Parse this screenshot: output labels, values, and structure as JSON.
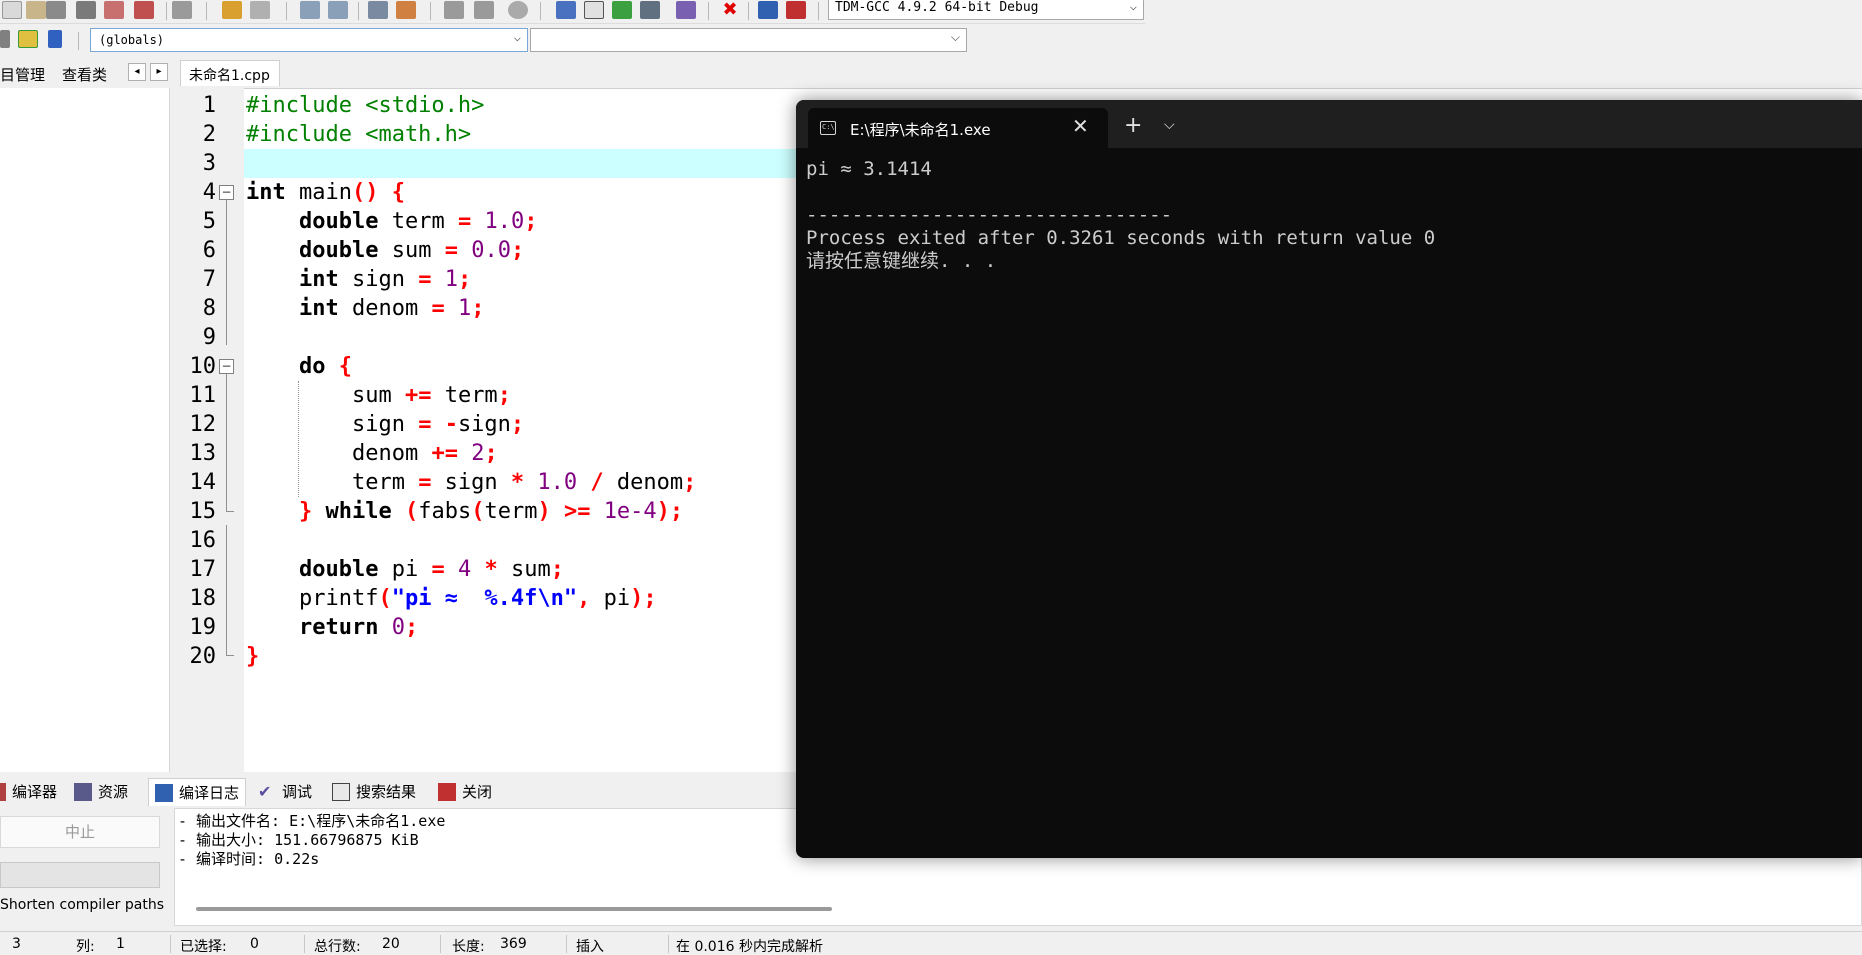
{
  "toolbar": {
    "compiler": "TDM-GCC 4.9.2 64-bit Debug",
    "scope": "(globals)"
  },
  "left_panel": {
    "tabs": [
      "目管理",
      "查看类"
    ]
  },
  "editor": {
    "file_tab": "未命名1.cpp",
    "current_line": 3,
    "lines": [
      "#include <stdio.h>",
      "#include <math.h>",
      "",
      "int main() {",
      "    double term = 1.0;",
      "    double sum = 0.0;",
      "    int sign = 1;",
      "    int denom = 1;",
      "",
      "    do {",
      "        sum += term;",
      "        sign = -sign;",
      "        denom += 2;",
      "        term = sign * 1.0 / denom;",
      "    } while (fabs(term) >= 1e-4);",
      "",
      "    double pi = 4 * sum;",
      "    printf(\"pi ≈  %.4f\\n\", pi);",
      "    return 0;",
      "}"
    ],
    "line_numbers": [
      "1",
      "2",
      "3",
      "4",
      "5",
      "6",
      "7",
      "8",
      "9",
      "10",
      "11",
      "12",
      "13",
      "14",
      "15",
      "16",
      "17",
      "18",
      "19",
      "20"
    ]
  },
  "bottom_panel": {
    "tabs": [
      {
        "label": "编译器",
        "icon": "compiler-icon"
      },
      {
        "label": "资源",
        "icon": "resources-icon"
      },
      {
        "label": "编译日志",
        "icon": "compile-log-icon"
      },
      {
        "label": "调试",
        "icon": "debug-icon"
      },
      {
        "label": "搜索结果",
        "icon": "search-results-icon"
      },
      {
        "label": "关闭",
        "icon": "close-icon"
      }
    ],
    "abort_label": "中止",
    "shorten_label": "Shorten compiler paths",
    "log_lines": [
      "- 输出文件名: E:\\程序\\未命名1.exe",
      "- 输出大小: 151.66796875 KiB",
      "- 编译时间: 0.22s"
    ]
  },
  "statusbar": {
    "row": "3",
    "col_label": "列:",
    "col": "1",
    "selected_label": "已选择:",
    "selected": "0",
    "total_lines_label": "总行数:",
    "total_lines": "20",
    "length_label": "长度:",
    "length": "369",
    "mode": "插入",
    "parse_msg": "在 0.016 秒内完成解析"
  },
  "terminal": {
    "tab_title": "E:\\程序\\未命名1.exe",
    "output": [
      "pi ≈ 3.1414",
      "",
      "--------------------------------",
      "Process exited after 0.3261 seconds with return value 0",
      "请按任意键继续. . ."
    ]
  },
  "colors": {
    "keyword": "#000000",
    "preprocessor": "#008000",
    "number": "#800080",
    "operator": "#ff0000",
    "string": "#0000ff",
    "current_line_bg": "#ccffff",
    "terminal_bg": "#0c0c0c",
    "terminal_fg": "#cccccc"
  }
}
